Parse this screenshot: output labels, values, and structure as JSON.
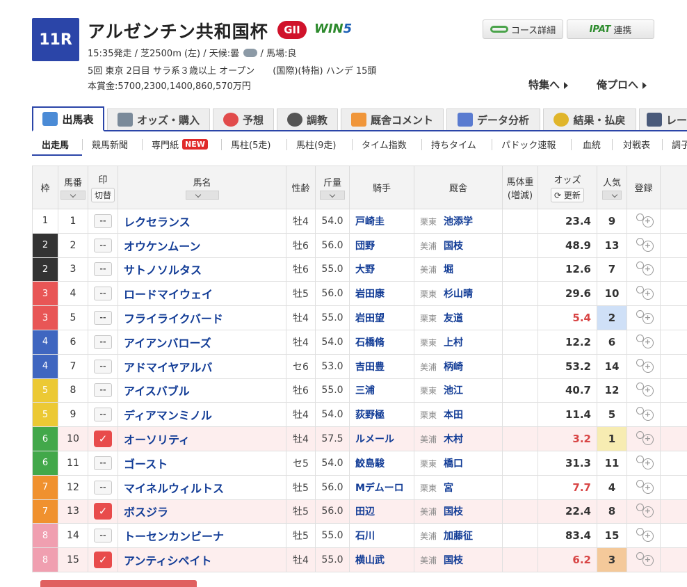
{
  "race": {
    "number": "11R",
    "name": "アルゼンチン共和国杯",
    "grade": "GII",
    "win5_a": "WIN",
    "win5_b": "5",
    "time_course": "15:35発走 / 芝2500m (左) / 天候:曇",
    "track": "/ 馬場:良",
    "details": "5回 東京 2日目 サラ系３歳以上 オープン　　(国際)(特指) ハンデ 15頭",
    "prize": "本賞金:5700,2300,1400,860,570万円"
  },
  "buttons": {
    "course": "コース詳細",
    "ipat_logo": "IPAT",
    "ipat": "連携"
  },
  "links": {
    "special": "特集へ",
    "ore_pro": "俺プロへ"
  },
  "tabs": [
    "出馬表",
    "オッズ・購入",
    "予想",
    "調教",
    "厩舎コメント",
    "データ分析",
    "結果・払戻",
    "レー"
  ],
  "subnav": [
    "出走馬",
    "競馬新聞",
    "専門紙",
    "馬柱(5走)",
    "馬柱(9走)",
    "タイム指数",
    "持ちタイム",
    "パドック速報",
    "血統",
    "対戦表",
    "調子"
  ],
  "new_badge": "NEW",
  "headers": {
    "waku": "枠",
    "umaban": "馬番",
    "mark": "印",
    "mark_toggle": "切替",
    "name": "馬名",
    "sexage": "性齢",
    "kinryo": "斤量",
    "jockey": "騎手",
    "stable": "厩舎",
    "weight": "馬体重",
    "weight_sub": "(増減)",
    "odds": "オッズ",
    "refresh": "更新",
    "ninki": "人気",
    "register": "登録"
  },
  "mark_empty": "--",
  "mark_check": "✓",
  "horses": [
    {
      "waku": "1",
      "num": "1",
      "marked": false,
      "name": "レクセランス",
      "sexage": "牡4",
      "kin": "54.0",
      "jockey": "戸崎圭",
      "region": "栗東",
      "trainer": "池添学",
      "odds": "23.4",
      "ninki": "9"
    },
    {
      "waku": "2",
      "num": "2",
      "marked": false,
      "name": "オウケンムーン",
      "sexage": "牡6",
      "kin": "56.0",
      "jockey": "団野",
      "region": "美浦",
      "trainer": "国枝",
      "odds": "48.9",
      "ninki": "13"
    },
    {
      "waku": "2",
      "num": "3",
      "marked": false,
      "name": "サトノソルタス",
      "sexage": "牡6",
      "kin": "55.0",
      "jockey": "大野",
      "region": "美浦",
      "trainer": "堀",
      "odds": "12.6",
      "ninki": "7"
    },
    {
      "waku": "3",
      "num": "4",
      "marked": false,
      "name": "ロードマイウェイ",
      "sexage": "牡5",
      "kin": "56.0",
      "jockey": "岩田康",
      "region": "栗東",
      "trainer": "杉山晴",
      "odds": "29.6",
      "ninki": "10"
    },
    {
      "waku": "3",
      "num": "5",
      "marked": false,
      "name": "フライライクバード",
      "sexage": "牡4",
      "kin": "55.0",
      "jockey": "岩田望",
      "region": "栗東",
      "trainer": "友道",
      "odds": "5.4",
      "ninki": "2"
    },
    {
      "waku": "4",
      "num": "6",
      "marked": false,
      "name": "アイアンバローズ",
      "sexage": "牡4",
      "kin": "54.0",
      "jockey": "石橋脩",
      "region": "栗東",
      "trainer": "上村",
      "odds": "12.2",
      "ninki": "6"
    },
    {
      "waku": "4",
      "num": "7",
      "marked": false,
      "name": "アドマイヤアルバ",
      "sexage": "セ6",
      "kin": "53.0",
      "jockey": "吉田豊",
      "region": "美浦",
      "trainer": "柄崎",
      "odds": "53.2",
      "ninki": "14"
    },
    {
      "waku": "5",
      "num": "8",
      "marked": false,
      "name": "アイスバブル",
      "sexage": "牡6",
      "kin": "55.0",
      "jockey": "三浦",
      "region": "栗東",
      "trainer": "池江",
      "odds": "40.7",
      "ninki": "12"
    },
    {
      "waku": "5",
      "num": "9",
      "marked": false,
      "name": "ディアマンミノル",
      "sexage": "牡4",
      "kin": "54.0",
      "jockey": "荻野極",
      "region": "栗東",
      "trainer": "本田",
      "odds": "11.4",
      "ninki": "5"
    },
    {
      "waku": "6",
      "num": "10",
      "marked": true,
      "name": "オーソリティ",
      "sexage": "牡4",
      "kin": "57.5",
      "jockey": "ルメール",
      "region": "美浦",
      "trainer": "木村",
      "odds": "3.2",
      "ninki": "1"
    },
    {
      "waku": "6",
      "num": "11",
      "marked": false,
      "name": "ゴースト",
      "sexage": "セ5",
      "kin": "54.0",
      "jockey": "鮫島駿",
      "region": "栗東",
      "trainer": "橋口",
      "odds": "31.3",
      "ninki": "11"
    },
    {
      "waku": "7",
      "num": "12",
      "marked": false,
      "name": "マイネルウィルトス",
      "sexage": "牡5",
      "kin": "56.0",
      "jockey": "Mデムーロ",
      "region": "栗東",
      "trainer": "宮",
      "odds": "7.7",
      "ninki": "4"
    },
    {
      "waku": "7",
      "num": "13",
      "marked": true,
      "name": "ボスジラ",
      "sexage": "牡5",
      "kin": "56.0",
      "jockey": "田辺",
      "region": "美浦",
      "trainer": "国枝",
      "odds": "22.4",
      "ninki": "8"
    },
    {
      "waku": "8",
      "num": "14",
      "marked": false,
      "name": "トーセンカンビーナ",
      "sexage": "牡5",
      "kin": "55.0",
      "jockey": "石川",
      "region": "美浦",
      "trainer": "加藤征",
      "odds": "83.4",
      "ninki": "15"
    },
    {
      "waku": "8",
      "num": "15",
      "marked": true,
      "name": "アンティシペイト",
      "sexage": "牡4",
      "kin": "55.0",
      "jockey": "横山武",
      "region": "美浦",
      "trainer": "国枝",
      "odds": "6.2",
      "ninki": "3"
    }
  ],
  "colors": {
    "waku": {
      "1": "#ffffff",
      "2": "#333333",
      "3": "#e85656",
      "4": "#3f66c0",
      "5": "#ecc934",
      "6": "#42a84a",
      "7": "#f0912e",
      "8": "#f09fb0"
    },
    "ninki1": "#f7ecb2",
    "ninki2": "#cfe0f7",
    "ninki3": "#f4c99a"
  }
}
